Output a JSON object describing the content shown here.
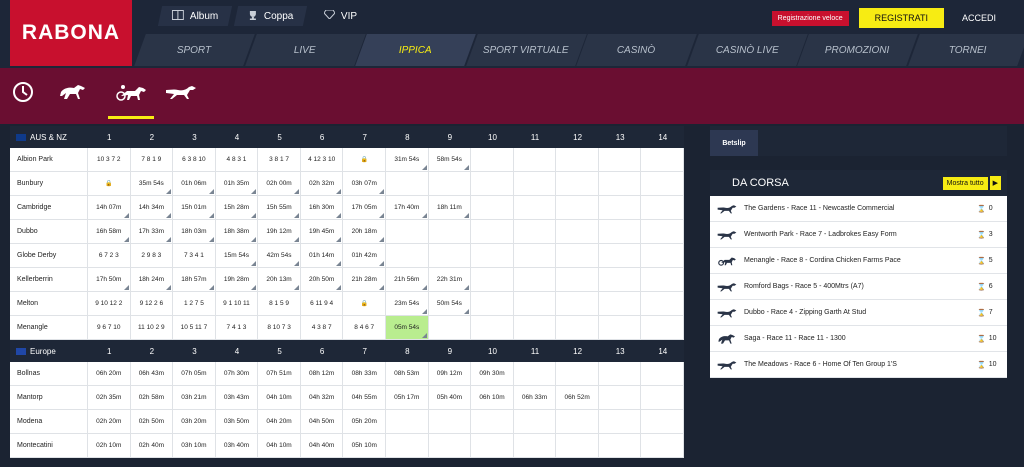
{
  "logo": "RABONA",
  "topnav": [
    {
      "label": "Album",
      "icon": "album-icon"
    },
    {
      "label": "Coppa",
      "icon": "trophy-icon"
    },
    {
      "label": "VIP",
      "icon": "diamond-icon"
    }
  ],
  "auth": {
    "fast_register": "Registrazione veloce",
    "register": "REGISTRATI",
    "login": "ACCEDI"
  },
  "mainnav": [
    "SPORT",
    "LIVE",
    "IPPICA",
    "SPORT VIRTUALE",
    "CASINÒ",
    "CASINÒ LIVE",
    "PROMOZIONI",
    "TORNEI"
  ],
  "mainnav_active": "IPPICA",
  "subnav": [
    "clock-icon",
    "horse-racing-icon",
    "harness-racing-icon",
    "greyhound-icon"
  ],
  "columns": [
    "1",
    "2",
    "3",
    "4",
    "5",
    "6",
    "7",
    "8",
    "9",
    "10",
    "11",
    "12",
    "13",
    "14"
  ],
  "regions": [
    {
      "name": "AUS & NZ",
      "tracks": [
        {
          "name": "Albion Park",
          "cells": [
            "10 3 7 2",
            "7 8 1 9",
            "6 3 8 10",
            "4 8 3 1",
            "3 8 1 7",
            "4 12 3 10",
            "🔒",
            "31m 54s",
            "58m 54s",
            "",
            "",
            "",
            "",
            ""
          ]
        },
        {
          "name": "Bunbury",
          "cells": [
            "🔒",
            "35m 54s",
            "01h 06m",
            "01h 35m",
            "02h 00m",
            "02h 32m",
            "03h 07m",
            "",
            "",
            "",
            "",
            "",
            "",
            ""
          ]
        },
        {
          "name": "Cambridge",
          "cells": [
            "14h 07m",
            "14h 34m",
            "15h 01m",
            "15h 28m",
            "15h 55m",
            "16h 30m",
            "17h 05m",
            "17h 40m",
            "18h 11m",
            "",
            "",
            "",
            "",
            ""
          ]
        },
        {
          "name": "Dubbo",
          "cells": [
            "16h 58m",
            "17h 33m",
            "18h 03m",
            "18h 38m",
            "19h 12m",
            "19h 45m",
            "20h 18m",
            "",
            "",
            "",
            "",
            "",
            "",
            ""
          ]
        },
        {
          "name": "Globe Derby",
          "cells": [
            "6 7 2 3",
            "2 9 8 3",
            "7 3 4 1",
            "15m 54s",
            "42m 54s",
            "01h 14m",
            "01h 42m",
            "",
            "",
            "",
            "",
            "",
            "",
            ""
          ]
        },
        {
          "name": "Kellerberrin",
          "cells": [
            "17h 50m",
            "18h 24m",
            "18h 57m",
            "19h 28m",
            "20h 13m",
            "20h 50m",
            "21h 28m",
            "21h 56m",
            "22h 31m",
            "",
            "",
            "",
            "",
            ""
          ]
        },
        {
          "name": "Melton",
          "cells": [
            "9 10 12 2",
            "9 12 2 6",
            "1 2 7 5",
            "9 1 10 11",
            "8 1 5 9",
            "6 11 9 4",
            "🔒",
            "23m 54s",
            "50m 54s",
            "",
            "",
            "",
            "",
            ""
          ]
        },
        {
          "name": "Menangle",
          "cells": [
            "9 6 7 10",
            "11 10 2 9",
            "10 5 11 7",
            "7 4 1 3",
            "8 10 7 3",
            "4 3 8 7",
            "8 4 6 7",
            "05m 54s",
            "",
            "",
            "",
            "",
            "",
            ""
          ]
        }
      ]
    },
    {
      "name": "Europe",
      "tracks": [
        {
          "name": "Bollnas",
          "cells": [
            "06h 20m",
            "06h 43m",
            "07h 05m",
            "07h 30m",
            "07h 51m",
            "08h 12m",
            "08h 33m",
            "08h 53m",
            "09h 12m",
            "09h 30m",
            "",
            "",
            "",
            ""
          ]
        },
        {
          "name": "Mantorp",
          "cells": [
            "02h 35m",
            "02h 58m",
            "03h 21m",
            "03h 43m",
            "04h 10m",
            "04h 32m",
            "04h 55m",
            "05h 17m",
            "05h 40m",
            "06h 10m",
            "06h 33m",
            "06h 52m",
            "",
            ""
          ]
        },
        {
          "name": "Modena",
          "cells": [
            "02h 20m",
            "02h 50m",
            "03h 20m",
            "03h 50m",
            "04h 20m",
            "04h 50m",
            "05h 20m",
            "",
            "",
            "",
            "",
            "",
            "",
            ""
          ]
        },
        {
          "name": "Montecatini",
          "cells": [
            "02h 10m",
            "02h 40m",
            "03h 10m",
            "03h 40m",
            "04h 10m",
            "04h 40m",
            "05h 10m",
            "",
            "",
            "",
            "",
            "",
            "",
            ""
          ]
        }
      ]
    }
  ],
  "betslip": {
    "tab": "Betslip"
  },
  "dacorsa": {
    "title": "DA CORSA",
    "show_all": "Mostra tutto",
    "races": [
      {
        "name": "The Gardens - Race 11 - Newcastle Commercial",
        "count": "0",
        "icon": "greyhound-icon"
      },
      {
        "name": "Wentworth Park - Race 7 - Ladbrokes Easy Form",
        "count": "3",
        "icon": "greyhound-icon"
      },
      {
        "name": "Menangle - Race 8 - Cordina Chicken Farms Pace",
        "count": "5",
        "icon": "harness-racing-icon"
      },
      {
        "name": "Romford Bags - Race 5 - 400Mtrs (A7)",
        "count": "6",
        "icon": "greyhound-icon"
      },
      {
        "name": "Dubbo - Race 4 - Zipping Garth At Stud",
        "count": "7",
        "icon": "greyhound-icon"
      },
      {
        "name": "Saga - Race 11 - Race 11 - 1300",
        "count": "10",
        "icon": "horse-racing-icon"
      },
      {
        "name": "The Meadows - Race 6 - Home Of Ten Group 1'S",
        "count": "10",
        "icon": "greyhound-icon"
      }
    ]
  }
}
